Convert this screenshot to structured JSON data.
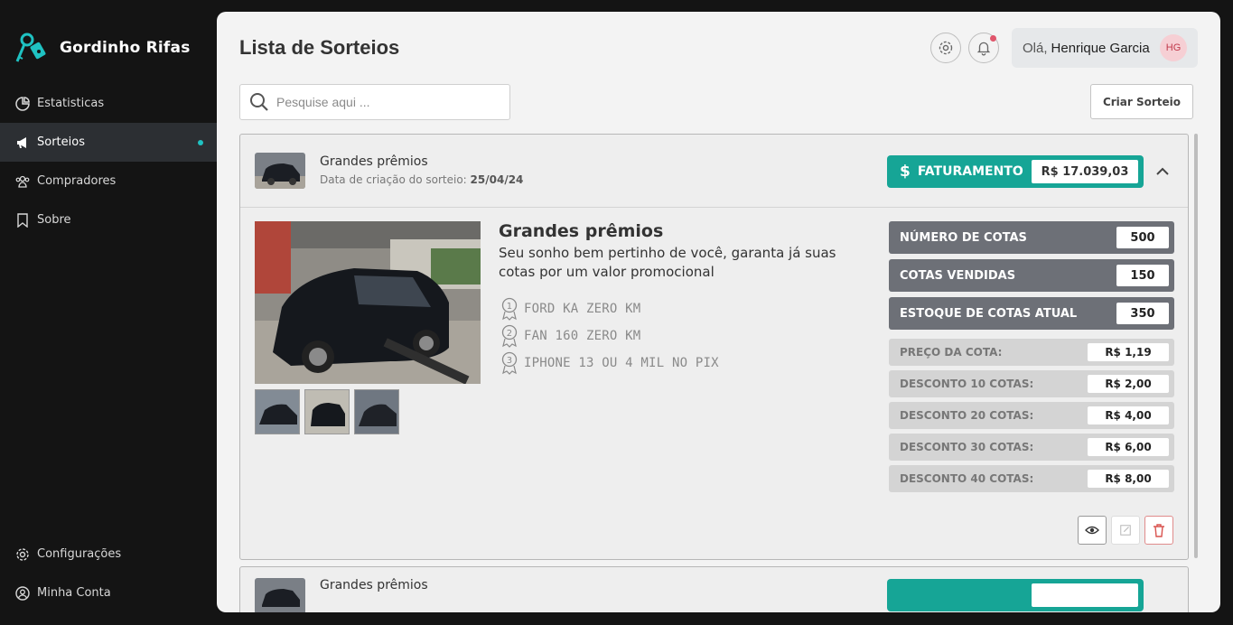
{
  "brand": {
    "name": "Gordinho Rifas"
  },
  "nav": {
    "items": [
      {
        "label": "Estatisticas",
        "icon": "pie-chart-icon"
      },
      {
        "label": "Sorteios",
        "icon": "megaphone-icon"
      },
      {
        "label": "Compradores",
        "icon": "users-icon"
      },
      {
        "label": "Sobre",
        "icon": "bookmark-icon"
      }
    ],
    "bottom": [
      {
        "label": "Configurações",
        "icon": "gear-icon"
      },
      {
        "label": "Minha Conta",
        "icon": "user-circle-icon"
      }
    ]
  },
  "header": {
    "title": "Lista de Sorteios",
    "greeting": "Olá,",
    "user_name": "Henrique Garcia",
    "avatar_initials": "HG"
  },
  "search": {
    "placeholder": "Pesquise aqui ..."
  },
  "create_button": "Criar Sorteio",
  "raffle": {
    "title": "Grandes prêmios",
    "date_label": "Data de criação do sorteio:",
    "date": "25/04/24",
    "faturamento_label": "FATURAMENTO",
    "faturamento_value": "R$ 17.039,03",
    "headline": "Grandes prêmios",
    "subtitle": "Seu sonho bem pertinho de você, garanta já suas cotas por um valor promocional",
    "prizes": [
      "FORD KA ZERO KM",
      "FAN 160 ZERO KM",
      "IPHONE 13 OU 4 MIL NO PIX"
    ],
    "stats": [
      {
        "label": "NÚMERO DE COTAS",
        "value": "500"
      },
      {
        "label": "COTAS VENDIDAS",
        "value": "150"
      },
      {
        "label": "ESTOQUE DE COTAS ATUAL",
        "value": "350"
      }
    ],
    "prices": [
      {
        "label": "PREÇO DA COTA:",
        "value": "R$ 1,19"
      },
      {
        "label": "DESCONTO 10 COTAS:",
        "value": "R$ 2,00"
      },
      {
        "label": "DESCONTO 20 COTAS:",
        "value": "R$ 4,00"
      },
      {
        "label": "DESCONTO 30 COTAS:",
        "value": "R$ 6,00"
      },
      {
        "label": "DESCONTO 40 COTAS:",
        "value": "R$ 8,00"
      }
    ]
  },
  "raffle2": {
    "title": "Grandes prêmios"
  },
  "colors": {
    "accent": "#16a596",
    "sidebar": "#141414",
    "danger": "#d9534f"
  }
}
